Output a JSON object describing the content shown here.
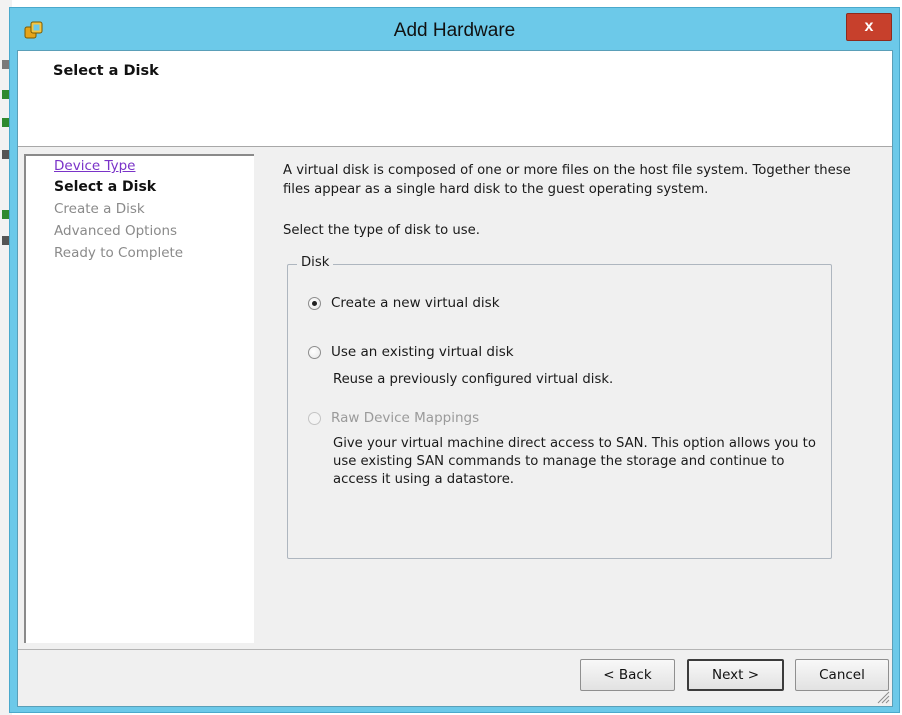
{
  "window": {
    "title": "Add Hardware",
    "close_label": "x",
    "accent": "#6cc9e9",
    "close_color": "#c7402c"
  },
  "header": {
    "title": "Select a Disk"
  },
  "steps": [
    {
      "label": "Device Type",
      "state": "completed"
    },
    {
      "label": "Select a Disk",
      "state": "current"
    },
    {
      "label": "Create a Disk",
      "state": "pending"
    },
    {
      "label": "Advanced Options",
      "state": "pending"
    },
    {
      "label": "Ready to Complete",
      "state": "pending"
    }
  ],
  "content": {
    "description": "A virtual disk is composed of one or more files on the host file system. Together these files appear as a single hard disk to the guest operating system.",
    "prompt": "Select the type of disk to use.",
    "group_label": "Disk",
    "options": [
      {
        "label": "Create a new virtual disk",
        "selected": true,
        "enabled": true,
        "description": ""
      },
      {
        "label": "Use an existing virtual disk",
        "selected": false,
        "enabled": true,
        "description": "Reuse a previously configured virtual disk."
      },
      {
        "label": "Raw Device Mappings",
        "selected": false,
        "enabled": false,
        "description": "Give your virtual machine direct access to SAN. This option allows you to use existing SAN commands to manage the storage and continue to access it using a datastore."
      }
    ]
  },
  "buttons": {
    "back": "< Back",
    "next": "Next >",
    "cancel": "Cancel"
  }
}
